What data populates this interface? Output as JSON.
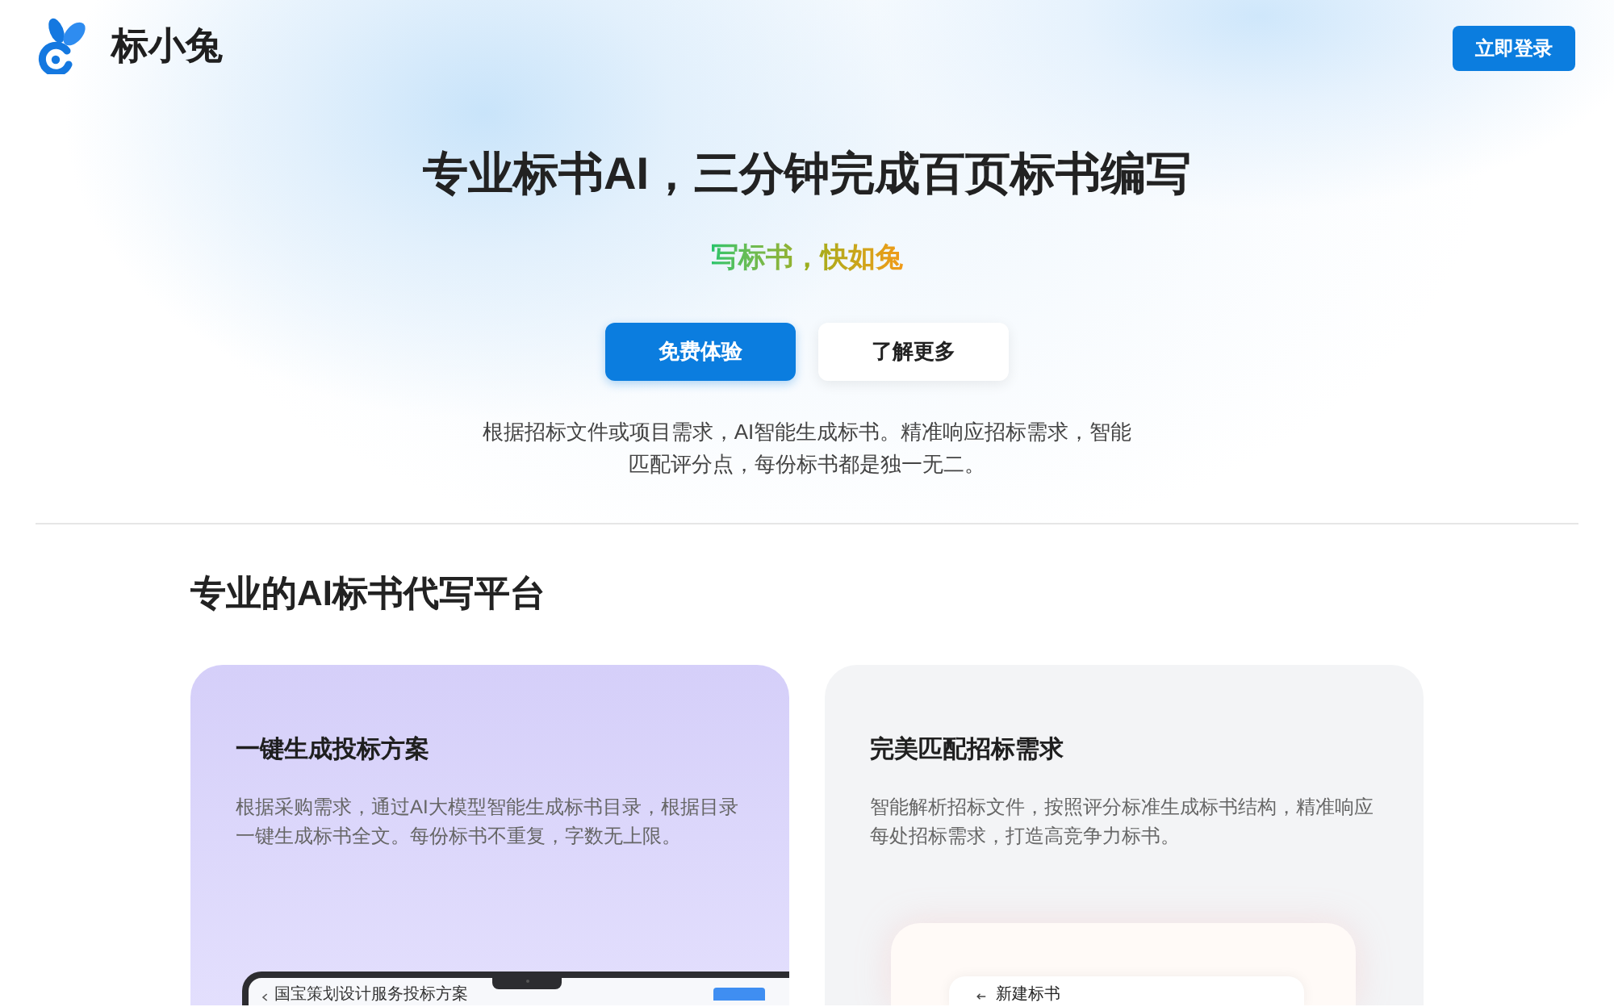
{
  "header": {
    "logo_text": "标小兔",
    "login_button": "立即登录"
  },
  "hero": {
    "title": "专业标书AI，三分钟完成百页标书编写",
    "slogan": "写标书，快如兔",
    "buttons": [
      {
        "label": "免费体验",
        "kind": "primary"
      },
      {
        "label": "了解更多",
        "kind": "secondary"
      }
    ],
    "description_lines": [
      "根据招标文件或项目需求，AI智能生成标书。精准响应招标需求，智能",
      "匹配评分点，每份标书都是独一无二。"
    ]
  },
  "features": {
    "title": "专业的AI标书代写平台",
    "cards": [
      {
        "kind": "laptop",
        "title": "一键生成投标方案",
        "text_lines": [
          "根据采购需求，通过AI大模型智能生成标书目录，根据目录",
          "一键生成标书全文。每份标书不重复，字数无上限。"
        ],
        "mockup": {
          "doc_title": "国宝策划设计服务投标方案"
        }
      },
      {
        "kind": "form",
        "title": "完美匹配招标需求",
        "text_lines": [
          "智能解析招标文件，按照评分标准生成标书结构，精准响应",
          "每处招标需求，打造高竞争力标书。"
        ],
        "mockup": {
          "page_title": "新建标书"
        }
      }
    ]
  }
}
